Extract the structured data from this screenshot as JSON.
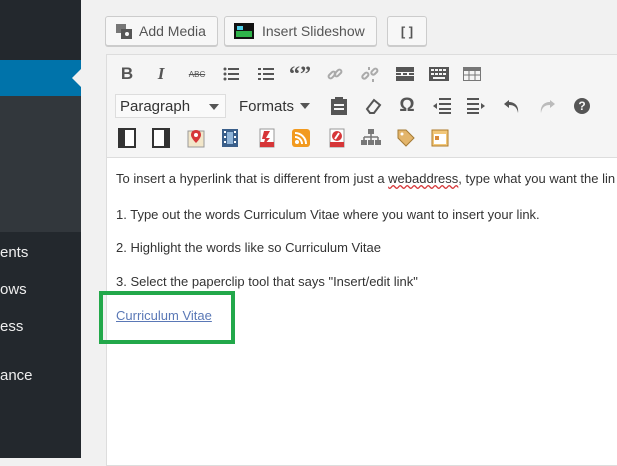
{
  "sidebar": {
    "items": [
      {
        "label": "ents"
      },
      {
        "label": "ows"
      },
      {
        "label": "ess"
      },
      {
        "label": "ance"
      }
    ]
  },
  "media_buttons": {
    "add_media": "Add Media",
    "insert_slideshow": "Insert Slideshow",
    "fullscreen": "[ ]"
  },
  "toolbar": {
    "format_select": "Paragraph",
    "formats_menu": "Formats",
    "bold": "B",
    "italic": "I",
    "strikethrough": "ABC",
    "blockquote": "“”",
    "omega": "Ω",
    "help": "?"
  },
  "content": {
    "line1_a": "To insert a hyperlink that is different from just a ",
    "line1_squiggle": "webaddress",
    "line1_b": ", type what you want the lin",
    "line2": "1. Type out the words Curriculum Vitae where you want to insert your link.",
    "line3": "2. Highlight the words like so Curriculum Vitae",
    "line4": "3. Select the paperclip tool that says \"Insert/edit link\"",
    "link_text": "Curriculum Vitae"
  }
}
